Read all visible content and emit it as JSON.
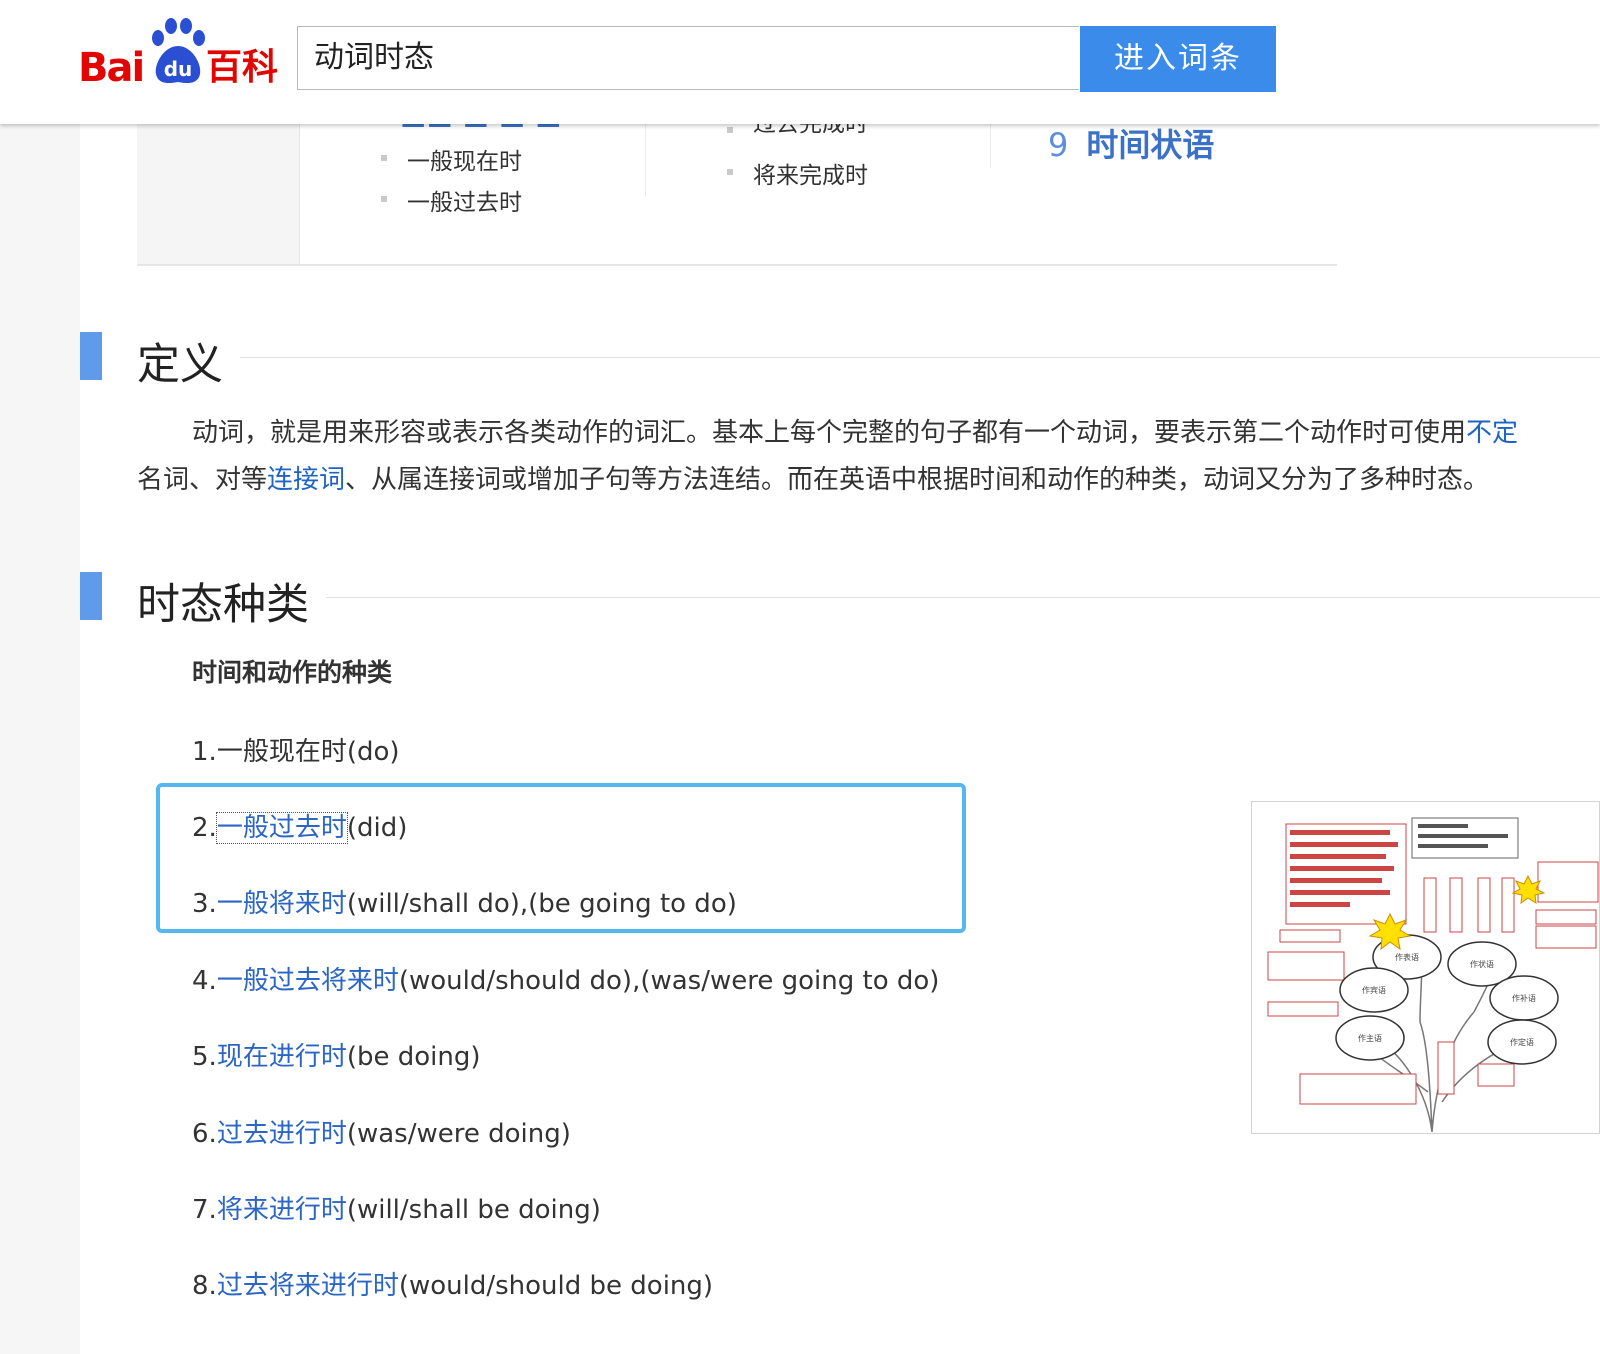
{
  "header": {
    "logo_bai": "Bai",
    "logo_du": "du",
    "logo_baike": "百科",
    "search_value": "动词时态",
    "search_button": "进入词条"
  },
  "catalog": {
    "col1_items": [
      "一般现在时",
      "一般过去时"
    ],
    "col2_items": [
      "过去完成时",
      "将来完成时"
    ],
    "item9_num": "9",
    "item9_label": "时间状语"
  },
  "section_definition": {
    "title": "定义",
    "line1_text": "动词，就是用来形容或表示各类动作的词汇。基本上每个完整的句子都有一个动词，要表示第二个动作时可使用",
    "line1_link": "不定",
    "line2_prefix": "名词、对等",
    "line2_link": "连接词",
    "line2_suffix": "、从属连接词或增加子句等方法连结。而在英语中根据时间和动作的种类，动词又分为了多种时态。"
  },
  "section_types": {
    "title": "时态种类",
    "subheading": "时间和动作的种类",
    "items": [
      {
        "num": "1.",
        "link": "",
        "plain": "一般现在时",
        "rest": "(do)"
      },
      {
        "num": "2.",
        "link": "一般过去时",
        "plain": "",
        "rest": "(did)"
      },
      {
        "num": "3.",
        "link": "一般将来时",
        "plain": "",
        "rest": "(will/shall do),(be going to do)"
      },
      {
        "num": "4.",
        "link": "一般过去将来时",
        "plain": "",
        "rest": "(would/should do),(was/were going to do)"
      },
      {
        "num": "5.",
        "link": "现在进行时",
        "plain": "",
        "rest": "(be doing)"
      },
      {
        "num": "6.",
        "link": "过去进行时",
        "plain": "",
        "rest": "(was/were doing)"
      },
      {
        "num": "7.",
        "link": "将来进行时",
        "plain": "",
        "rest": "(will/shall be doing)"
      },
      {
        "num": "8.",
        "link": "过去将来进行时",
        "plain": "",
        "rest": "(would/should be doing)"
      }
    ]
  },
  "image": {
    "tree_labels": [
      "作表语",
      "作状语",
      "作宾语",
      "作补语",
      "作主语",
      "作定语"
    ]
  },
  "colors": {
    "accent": "#3b8cea",
    "link": "#2c66c5",
    "section_bar": "#5f9bea",
    "highlight_border": "#54b8ee",
    "logo_red": "#e10601"
  }
}
